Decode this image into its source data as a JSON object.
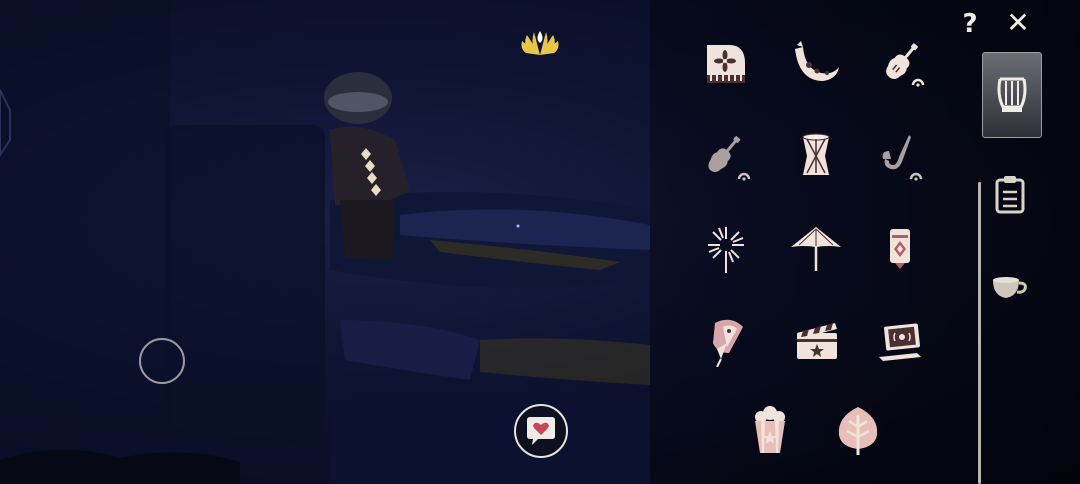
{
  "hud": {
    "help_label": "?",
    "close_label": "✕",
    "energy_icon": "wing-fan-icon",
    "move_joystick_icon": "ring-icon",
    "emote_button_icon": "heart-chat-icon"
  },
  "sidebar": {
    "tabs": [
      {
        "name": "instruments",
        "icon": "lyre-icon",
        "active": true
      },
      {
        "name": "props",
        "icon": "clipboard-icon",
        "active": false
      },
      {
        "name": "consumables",
        "icon": "teacup-icon",
        "active": false
      }
    ]
  },
  "grid": {
    "items": [
      {
        "icon": "piano-icon",
        "owned_indicator": false
      },
      {
        "icon": "crescent-horn-icon",
        "owned_indicator": false
      },
      {
        "icon": "violin-icon",
        "owned_indicator": true
      },
      {
        "icon": "cello-icon",
        "owned_indicator": true
      },
      {
        "icon": "drum-icon",
        "owned_indicator": false
      },
      {
        "icon": "saxophone-icon",
        "owned_indicator": true
      },
      {
        "icon": "firework-icon",
        "owned_indicator": false
      },
      {
        "icon": "umbrella-icon",
        "owned_indicator": false
      },
      {
        "icon": "lantern-icon",
        "owned_indicator": false
      },
      {
        "icon": "fan-pen-icon",
        "owned_indicator": false
      },
      {
        "icon": "clapperboard-icon",
        "owned_indicator": false
      },
      {
        "icon": "laptop-icon",
        "owned_indicator": false
      },
      {
        "icon": "popcorn-icon",
        "owned_indicator": false
      },
      {
        "icon": "leaf-icon",
        "owned_indicator": false
      }
    ]
  },
  "colors": {
    "icon_cream": "#efe3dc",
    "icon_dark": "#4a2f33",
    "accent_gold": "#e8c64a",
    "scene_bg": "#0d1230"
  }
}
